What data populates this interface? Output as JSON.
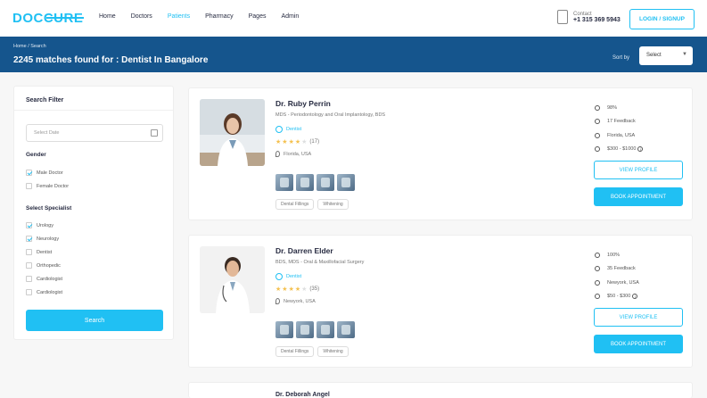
{
  "header": {
    "logo": "DOCCURE",
    "nav": [
      {
        "label": "Home",
        "active": false
      },
      {
        "label": "Doctors",
        "active": false
      },
      {
        "label": "Patients",
        "active": true
      },
      {
        "label": "Pharmacy",
        "active": false
      },
      {
        "label": "Pages",
        "active": false
      },
      {
        "label": "Admin",
        "active": false
      }
    ],
    "contact_label": "Contact",
    "contact_number": "+1 315 369 5943",
    "login_label": "LOGIN / SIGNUP"
  },
  "bar": {
    "breadcrumb": "Home / Search",
    "title": "2245 matches found for : Dentist In Bangalore",
    "sort_label": "Sort by",
    "sort_value": "Select"
  },
  "filter": {
    "title": "Search Filter",
    "date_placeholder": "Select Date",
    "gender_title": "Gender",
    "gender_options": [
      {
        "label": "Male Doctor",
        "checked": true
      },
      {
        "label": "Female Doctor",
        "checked": false
      }
    ],
    "specialist_title": "Select Specialist",
    "specialist_options": [
      {
        "label": "Urology",
        "checked": true
      },
      {
        "label": "Neurology",
        "checked": true
      },
      {
        "label": "Dentist",
        "checked": false
      },
      {
        "label": "Orthopedic",
        "checked": false
      },
      {
        "label": "Cardiologist",
        "checked": false
      },
      {
        "label": "Cardiologist",
        "checked": false
      }
    ],
    "search_label": "Search"
  },
  "doctors": [
    {
      "name": "Dr. Ruby Perrin",
      "specialty": "MDS - Periodontology and Oral Implantology, BDS",
      "department": "Dentist",
      "rating_stars": 4,
      "rating_count": "(17)",
      "location": "Florida, USA",
      "tags": [
        "Dental Fillings",
        "Whitening"
      ],
      "likes": "98%",
      "feedback": "17 Feedback",
      "city": "Florida, USA",
      "price": "$300 - $1000"
    },
    {
      "name": "Dr. Darren Elder",
      "specialty": "BDS, MDS - Oral & Maxillofacial Surgery",
      "department": "Dentist",
      "rating_stars": 4,
      "rating_count": "(35)",
      "location": "Newyork, USA",
      "tags": [
        "Dental Fillings",
        "Whitening"
      ],
      "likes": "100%",
      "feedback": "35 Feedback",
      "city": "Newyork, USA",
      "price": "$50 - $300"
    },
    {
      "name": "Dr. Deborah Angel",
      "specialty": "",
      "department": "",
      "rating_stars": 0,
      "rating_count": "",
      "location": "",
      "tags": [],
      "likes": "",
      "feedback": "",
      "city": "",
      "price": ""
    }
  ],
  "buttons": {
    "view_profile": "VIEW PROFILE",
    "book": "BOOK APPOINTMENT"
  },
  "colors": {
    "accent": "#20c0f3",
    "bar": "#15558d",
    "star": "#f4c150"
  }
}
